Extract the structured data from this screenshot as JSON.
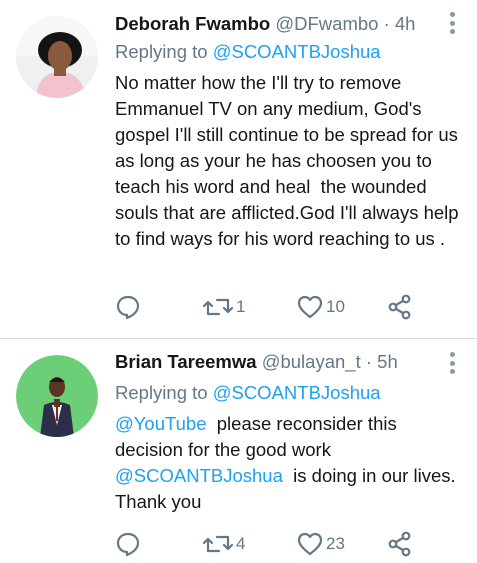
{
  "colors": {
    "accent": "#1da1f2",
    "muted": "#657786",
    "text": "#14171a",
    "divider": "#d9dde1"
  },
  "tweets": [
    {
      "name": "Deborah Fwambo",
      "handle": "@DFwambo",
      "dot": "·",
      "time": "4h",
      "replying_prefix": "Replying to ",
      "replying_to": "@SCOANTBJoshua",
      "text": "No matter how the I'll try to remove Emmanuel TV on any medium, God's gospel I'll still continue to be spread for us as long as your he has choosen you to teach his word and heal  the wounded souls that are afflicted.God I'll always help to find ways for his word reaching to us .",
      "retweets": "1",
      "likes": "10",
      "icons": [
        "reply-icon",
        "retweet-icon",
        "like-icon",
        "share-icon",
        "more-icon"
      ]
    },
    {
      "name": "Brian Tareemwa",
      "handle": "@bulayan_t",
      "dot": "·",
      "time": "5h",
      "replying_prefix": "Replying to ",
      "replying_to": "@SCOANTBJoshua",
      "text_mention_1": "@YouTube",
      "text_part_1": "  please reconsider this decision for the good work ",
      "text_mention_2": "@SCOANTBJoshua",
      "text_part_2": "  is doing in our lives. Thank you",
      "retweets": "4",
      "likes": "23",
      "icons": [
        "reply-icon",
        "retweet-icon",
        "like-icon",
        "share-icon",
        "more-icon"
      ]
    }
  ]
}
